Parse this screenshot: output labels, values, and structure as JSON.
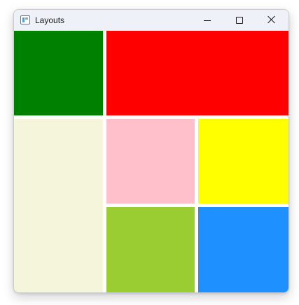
{
  "window": {
    "title": "Layouts",
    "icon": "app-window-icon",
    "controls": [
      "minimize-icon",
      "maximize-icon",
      "close-icon"
    ]
  },
  "panels": [
    {
      "name": "green",
      "color": "#008000"
    },
    {
      "name": "red",
      "color": "#ff0000"
    },
    {
      "name": "beige",
      "color": "#f5f5dc"
    },
    {
      "name": "pink",
      "color": "#ffc0cb"
    },
    {
      "name": "yellow",
      "color": "#ffff00"
    },
    {
      "name": "yellowgreen",
      "color": "#9acd32"
    },
    {
      "name": "dodgerblue",
      "color": "#1e90ff"
    }
  ]
}
